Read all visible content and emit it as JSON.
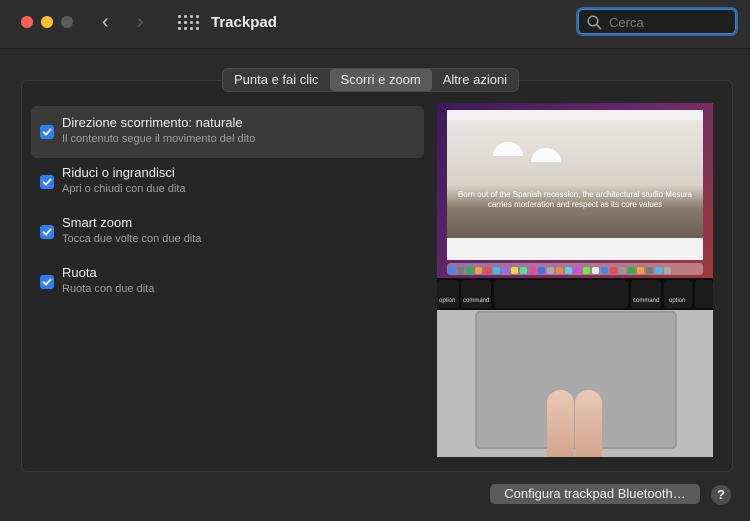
{
  "window": {
    "title": "Trackpad"
  },
  "search": {
    "placeholder": "Cerca"
  },
  "tabs": [
    {
      "label": "Punta e fai clic",
      "active": false
    },
    {
      "label": "Scorri e zoom",
      "active": true
    },
    {
      "label": "Altre azioni",
      "active": false
    }
  ],
  "options": [
    {
      "title": "Direzione scorrimento: naturale",
      "subtitle": "Il contenuto segue il movimento del dito",
      "checked": true,
      "selected": true
    },
    {
      "title": "Riduci o ingrandisci",
      "subtitle": "Apri o chiudi con due dita",
      "checked": true,
      "selected": false
    },
    {
      "title": "Smart zoom",
      "subtitle": "Tocca due volte con due dita",
      "checked": true,
      "selected": false
    },
    {
      "title": "Ruota",
      "subtitle": "Ruota con due dita",
      "checked": true,
      "selected": false
    }
  ],
  "preview": {
    "headline": "Born out of the Spanish recession, the architectural studio Mesura carries moderation and respect as its core values",
    "keys": {
      "left_cmd": "command",
      "left_opt": "option",
      "right_cmd": "command",
      "right_opt": "option"
    }
  },
  "footer": {
    "bluetooth_button": "Configura trackpad Bluetooth…",
    "help": "?"
  },
  "colors": {
    "accent": "#2f7ff0",
    "focus_ring": "#2f6aa3"
  }
}
